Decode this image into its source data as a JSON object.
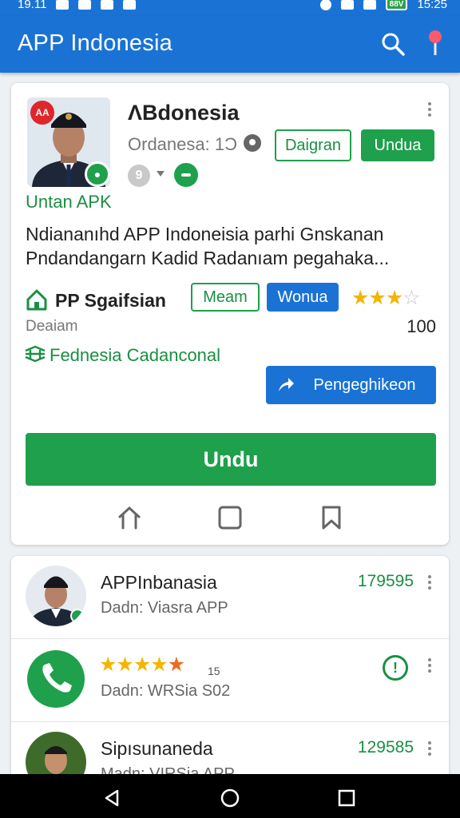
{
  "status_bar": {
    "left_time": "19.11",
    "right_time": "15:25",
    "battery_label": "88V"
  },
  "app_bar": {
    "title": "APP Indonesia",
    "icons": [
      "search-icon",
      "map-pin-icon"
    ]
  },
  "featured": {
    "name": "ΛBdonesia",
    "subtitle": "Ordanesa: 1Ͻ",
    "red_badge_text": "AA",
    "primary_outline_button": "Daigran",
    "primary_green_button": "Undua",
    "grey_chip": "9",
    "untan_link": "Untan APK",
    "description": "Ndiananıhd APP Indoneisia parhi Gnskanan Pndandangarn Kadid Radanıam pegahaka...",
    "row_label": "PP Sgaifsian",
    "row_outline_button": "Meam",
    "row_blue_button": "Wonua",
    "rating_stars": 3,
    "rating_max": 5,
    "secondary_label": "Deaiam",
    "rating_count": "100",
    "sign_link": "Fednesia Cadanconal",
    "action_button": "Pengeghikeon",
    "big_button": "Undu"
  },
  "list": [
    {
      "title": "APPInbanasia",
      "subtitle": "Dadn: Viasra APP",
      "count": "179595"
    },
    {
      "title": "",
      "subtitle": "Dadn: WRSia S02",
      "rating_stars": 5,
      "rating_label": "15"
    },
    {
      "title": "Sipısunaneda",
      "subtitle": "Madn: VIRSia APP",
      "count": "129585"
    }
  ],
  "colors": {
    "primary_blue": "#1a73d4",
    "primary_green": "#1ea04c",
    "star_yellow": "#f5b400",
    "badge_red": "#e0252b"
  }
}
